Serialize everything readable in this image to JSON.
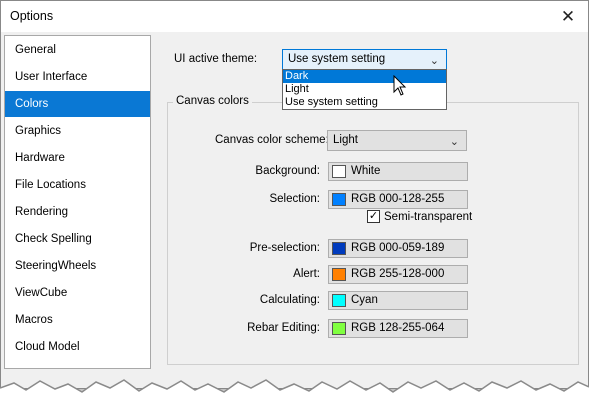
{
  "window": {
    "title": "Options",
    "close_glyph": "✕"
  },
  "nav": {
    "items": [
      "General",
      "User Interface",
      "Colors",
      "Graphics",
      "Hardware",
      "File Locations",
      "Rendering",
      "Check Spelling",
      "SteeringWheels",
      "ViewCube",
      "Macros",
      "Cloud Model"
    ],
    "selected": "Colors"
  },
  "ui_theme": {
    "label": "UI active theme:",
    "value": "Use system setting",
    "options": [
      "Dark",
      "Light",
      "Use system setting"
    ],
    "highlighted": "Dark"
  },
  "canvas": {
    "group_title": "Canvas colors",
    "scheme_label": "Canvas color scheme:",
    "scheme_value": "Light",
    "rows": {
      "background": {
        "label": "Background:",
        "value": "White",
        "color": "#ffffff"
      },
      "selection": {
        "label": "Selection:",
        "value": "RGB 000-128-255",
        "color": "#0080ff"
      },
      "preselection": {
        "label": "Pre-selection:",
        "value": "RGB 000-059-189",
        "color": "#003bbd"
      },
      "alert": {
        "label": "Alert:",
        "value": "RGB 255-128-000",
        "color": "#ff8000"
      },
      "calculating": {
        "label": "Calculating:",
        "value": "Cyan",
        "color": "#00ffff"
      },
      "rebar": {
        "label": "Rebar Editing:",
        "value": "RGB 128-255-064",
        "color": "#80ff40"
      }
    },
    "semi_transparent": {
      "label": "Semi-transparent",
      "checked": true
    }
  },
  "colors": {
    "accent": "#0a78d4",
    "dialog_bg": "#f0f0f0"
  }
}
